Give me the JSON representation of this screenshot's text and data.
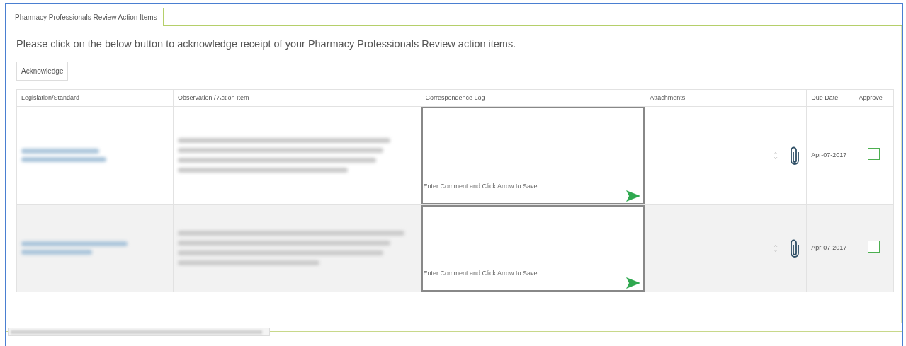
{
  "tabs": [
    {
      "label": "Pharmacy Professionals Review Action Items",
      "selected": true
    }
  ],
  "instruction": "Please click on the below button to acknowledge receipt of your Pharmacy Professionals Review action items.",
  "acknowledge_button": "Acknowledge",
  "table": {
    "columns": [
      "Legislation/Standard",
      "Observation / Action Item",
      "Correspondence Log",
      "Attachments",
      "Due Date",
      "Approve"
    ],
    "rows": [
      {
        "comment_placeholder": "Enter Comment and Click Arrow to Save.",
        "due_date": "Apr-07-2017",
        "approved": false
      },
      {
        "comment_placeholder": "Enter Comment and Click Arrow to Save.",
        "due_date": "Apr-07-2017",
        "approved": false
      }
    ]
  }
}
